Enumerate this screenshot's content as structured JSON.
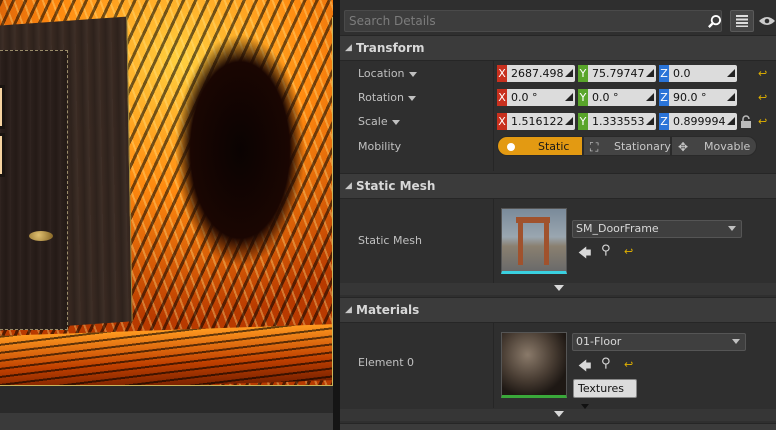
{
  "search": {
    "placeholder": "Search Details"
  },
  "sections": {
    "transform": {
      "title": "Transform"
    },
    "static_mesh": {
      "title": "Static Mesh"
    },
    "materials": {
      "title": "Materials"
    }
  },
  "transform": {
    "location": {
      "label": "Location",
      "x": "2687.498",
      "y": "75.79747",
      "z": "0.0"
    },
    "rotation": {
      "label": "Rotation",
      "x": "0.0 °",
      "y": "0.0 °",
      "z": "90.0 °"
    },
    "scale": {
      "label": "Scale",
      "x": "1.516122",
      "y": "1.333553",
      "z": "0.899994"
    },
    "mobility": {
      "label": "Mobility",
      "options": [
        "Static",
        "Stationary",
        "Movable"
      ],
      "selected": "Static"
    }
  },
  "static_mesh": {
    "label": "Static Mesh",
    "asset": "SM_DoorFrame"
  },
  "materials": {
    "element_label": "Element 0",
    "asset": "01-Floor",
    "textures_label": "Textures"
  },
  "axis_labels": {
    "x": "X",
    "y": "Y",
    "z": "Z"
  },
  "icons": {
    "search": "search-icon",
    "grid": "grid-view-icon",
    "eye": "eye-icon",
    "reset": "reset-arrow-icon",
    "lock": "lock-icon",
    "use_selected": "arrow-left-icon",
    "browse": "magnifier-icon"
  },
  "colors": {
    "axis_x": "#c8301e",
    "axis_y": "#59a52a",
    "axis_z": "#2a74d8",
    "mobility_selected": "#e39a12",
    "reset_icon": "#e0b000"
  }
}
